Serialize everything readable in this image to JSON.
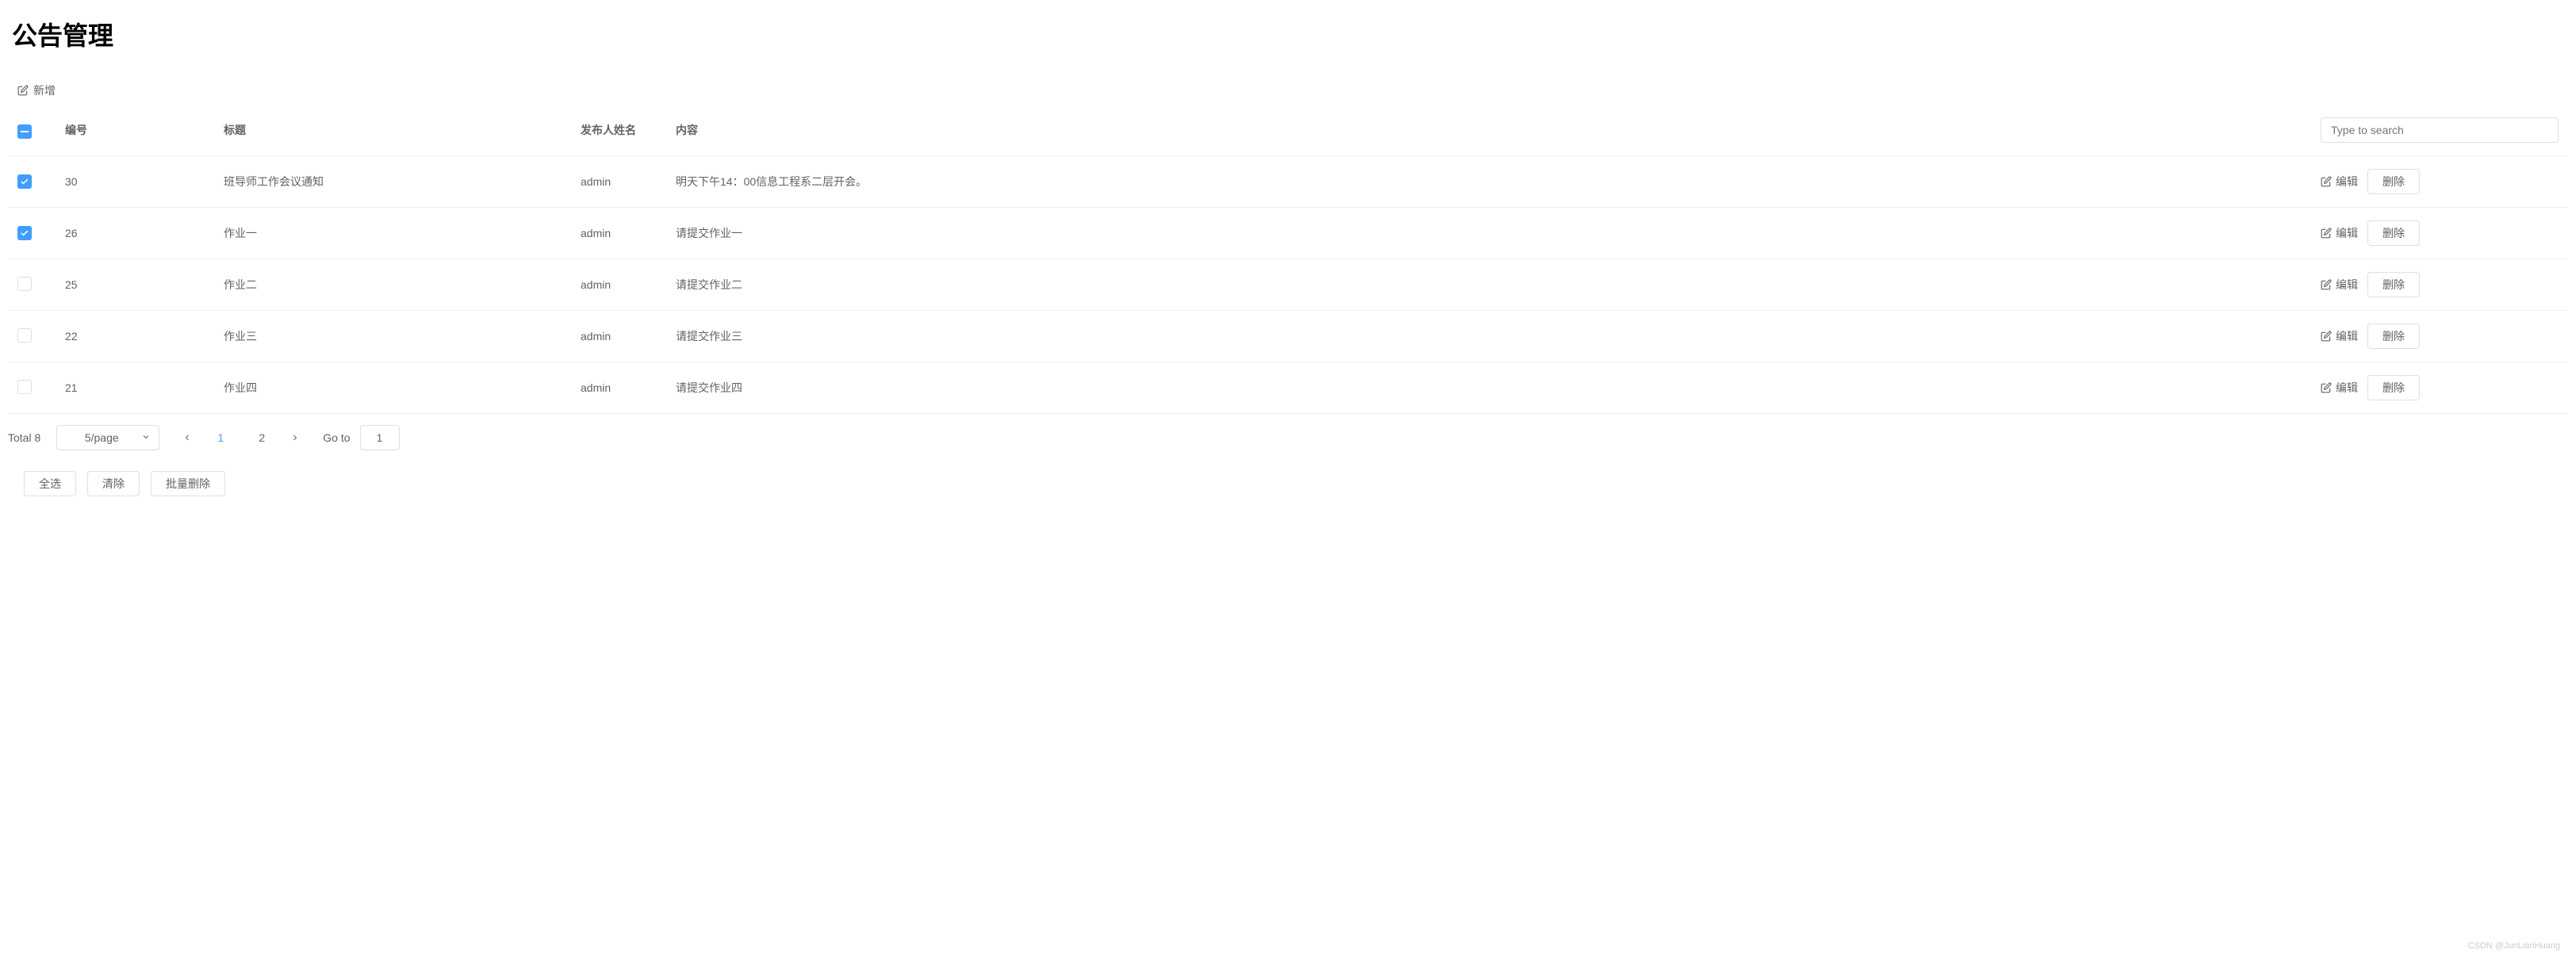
{
  "page": {
    "title": "公告管理"
  },
  "toolbar": {
    "add_label": "新增"
  },
  "table": {
    "headers": {
      "id": "编号",
      "title": "标题",
      "publisher": "发布人姓名",
      "content": "内容"
    },
    "search_placeholder": "Type to search",
    "rows": [
      {
        "checked": true,
        "id": "30",
        "title": "班导师工作会议通知",
        "publisher": "admin",
        "content": "明天下午14：00信息工程系二层开会。"
      },
      {
        "checked": true,
        "id": "26",
        "title": "作业一",
        "publisher": "admin",
        "content": "请提交作业一"
      },
      {
        "checked": false,
        "id": "25",
        "title": "作业二",
        "publisher": "admin",
        "content": "请提交作业二"
      },
      {
        "checked": false,
        "id": "22",
        "title": "作业三",
        "publisher": "admin",
        "content": "请提交作业三"
      },
      {
        "checked": false,
        "id": "21",
        "title": "作业四",
        "publisher": "admin",
        "content": "请提交作业四"
      }
    ],
    "edit_label": "编辑",
    "delete_label": "删除"
  },
  "pagination": {
    "total_label": "Total 8",
    "page_size_label": "5/page",
    "pages": [
      "1",
      "2"
    ],
    "current": "1",
    "goto_label": "Go to",
    "goto_value": "1"
  },
  "bulk": {
    "select_all": "全选",
    "clear": "清除",
    "batch_delete": "批量删除"
  },
  "watermark": "CSDN @JunLianHuang"
}
